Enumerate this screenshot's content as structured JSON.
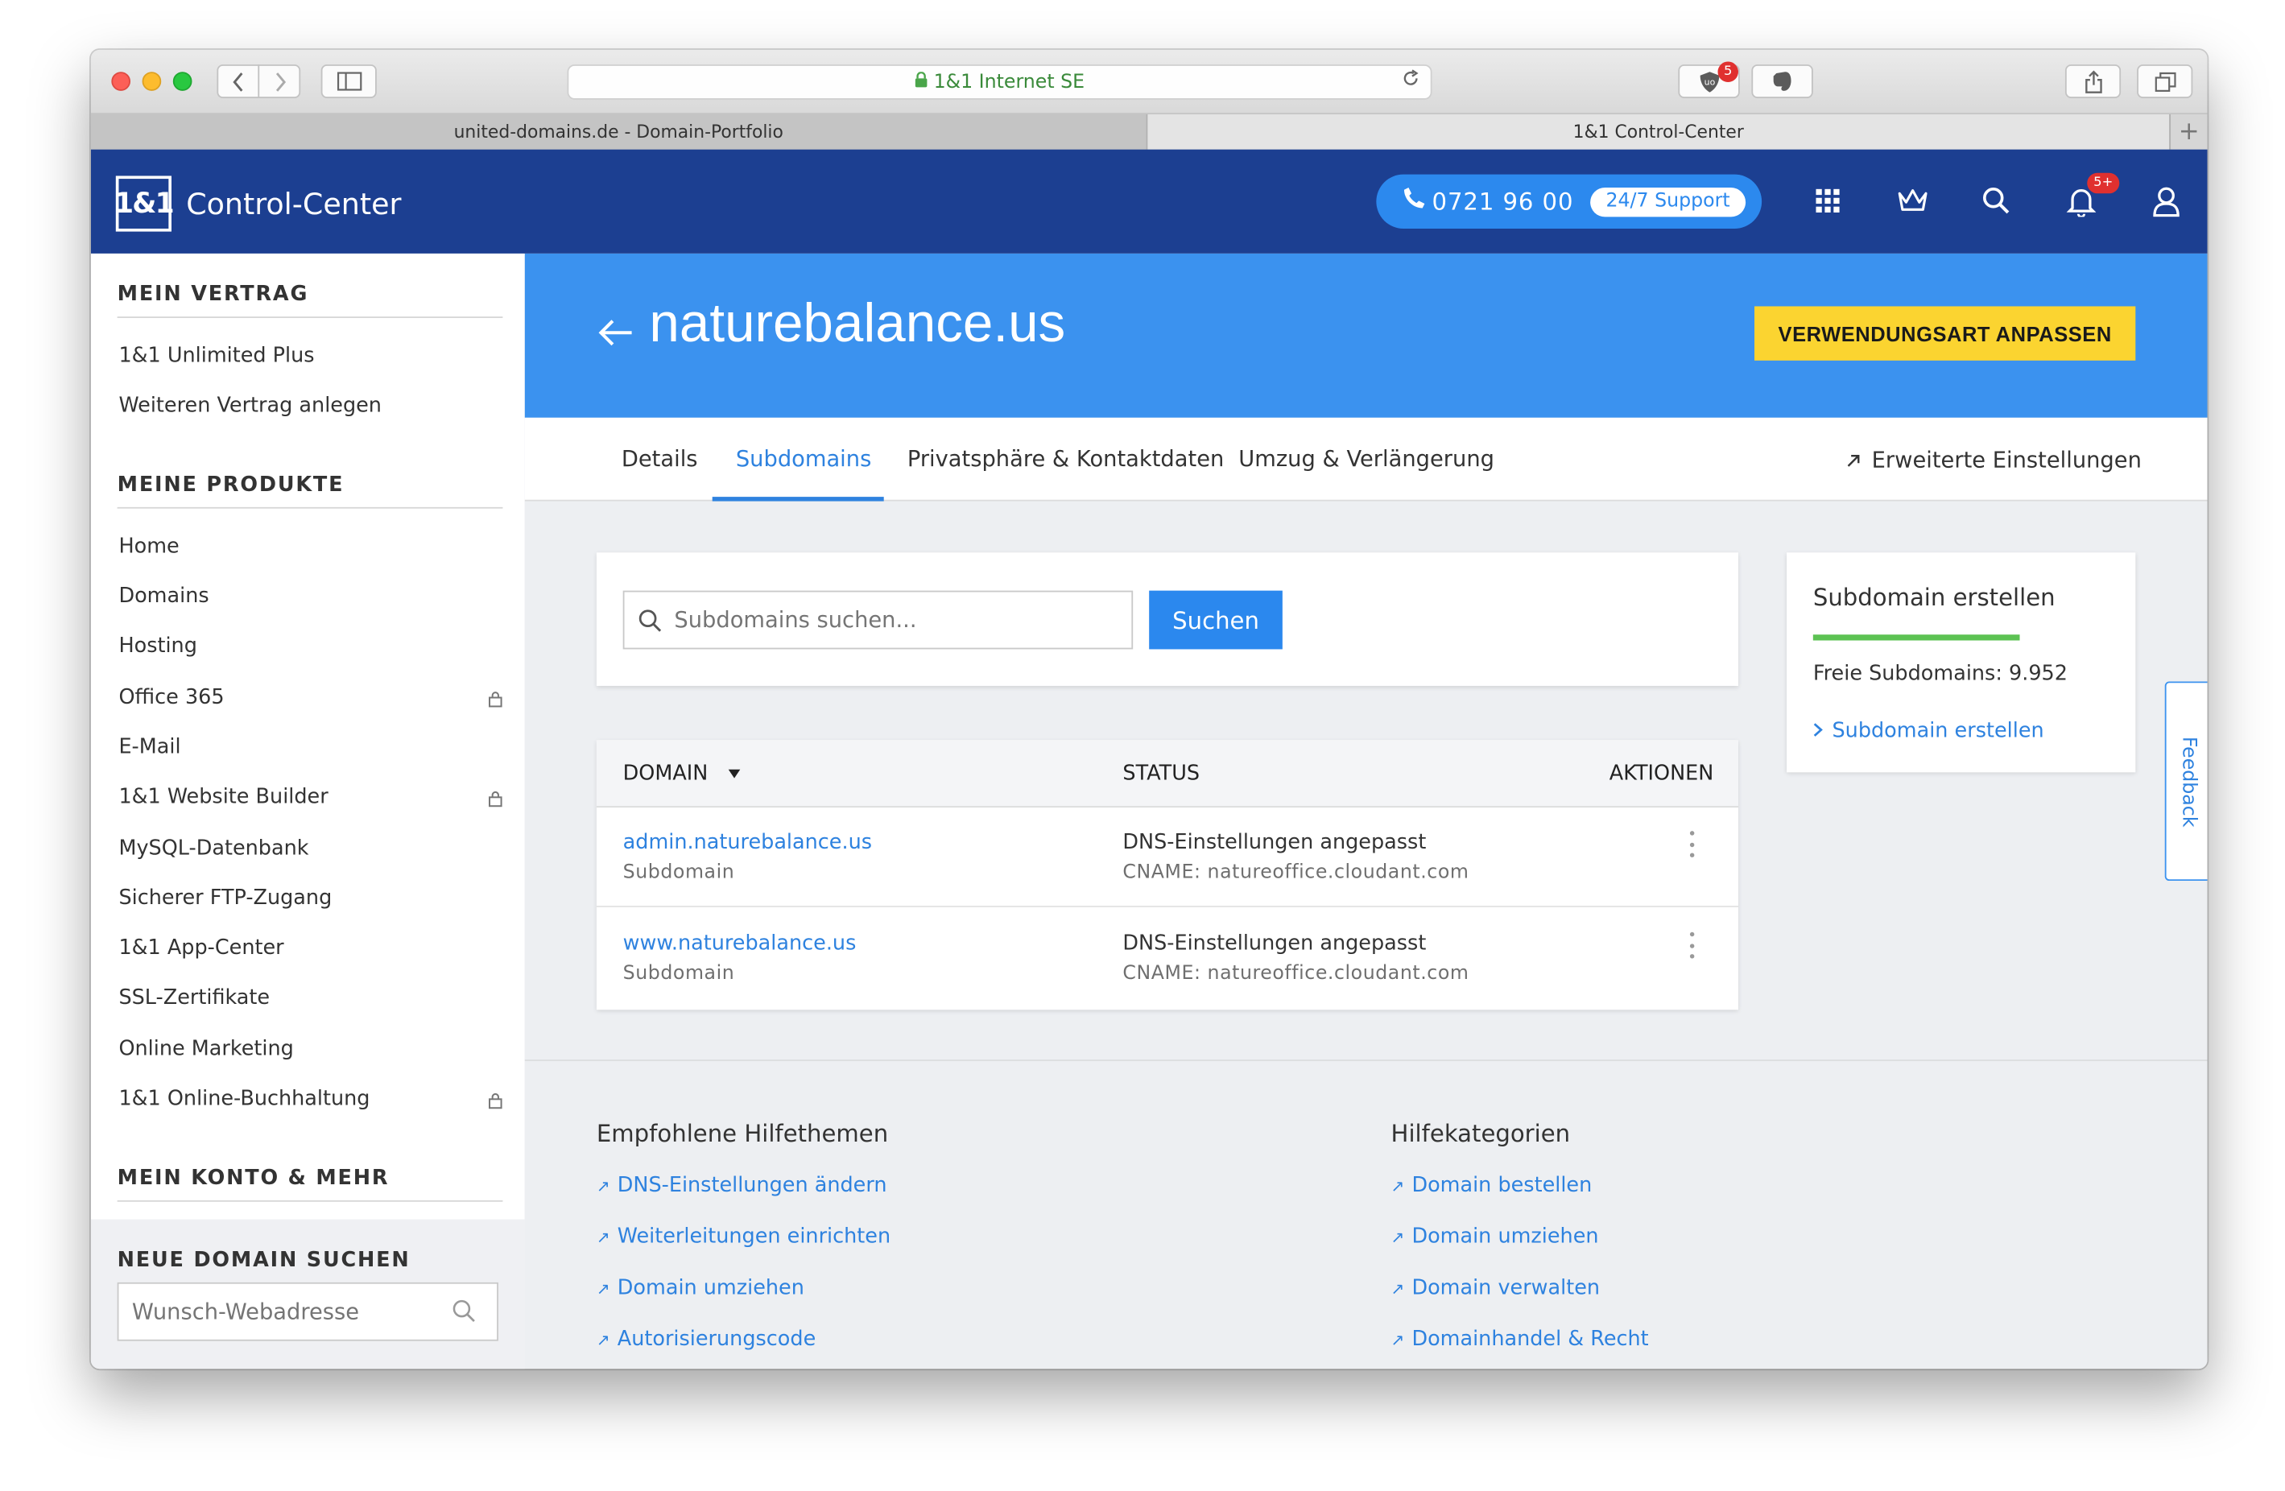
{
  "browser": {
    "url_text": "1&1 Internet SE",
    "ext_badge": "5",
    "tabs": [
      {
        "label": "united-domains.de - Domain-Portfolio"
      },
      {
        "label": "1&1 Control-Center"
      }
    ],
    "new_tab": "+"
  },
  "header": {
    "logo": "1&1",
    "title": "Control-Center",
    "phone": "0721 96 00",
    "support": "24/7 Support",
    "notifications_badge": "5+"
  },
  "sidebar": {
    "sections": [
      {
        "title": "MEIN VERTRAG",
        "items": [
          {
            "label": "1&1 Unlimited Plus"
          },
          {
            "label": "Weiteren Vertrag anlegen"
          }
        ]
      },
      {
        "title": "MEINE PRODUKTE",
        "items": [
          {
            "label": "Home"
          },
          {
            "label": "Domains"
          },
          {
            "label": "Hosting"
          },
          {
            "label": "Office 365",
            "locked": true
          },
          {
            "label": "E-Mail"
          },
          {
            "label": "1&1 Website Builder",
            "locked": true
          },
          {
            "label": "MySQL-Datenbank"
          },
          {
            "label": "Sicherer FTP-Zugang"
          },
          {
            "label": "1&1 App-Center"
          },
          {
            "label": "SSL-Zertifikate"
          },
          {
            "label": "Online Marketing"
          },
          {
            "label": "1&1 Online-Buchhaltung",
            "locked": true
          }
        ]
      },
      {
        "title": "MEIN KONTO & MEHR",
        "items": []
      }
    ],
    "domain_search": {
      "title": "NEUE DOMAIN SUCHEN",
      "placeholder": "Wunsch-Webadresse"
    }
  },
  "page": {
    "title": "naturebalance.us",
    "action_button": "VERWENDUNGSART ANPASSEN",
    "tabs": [
      {
        "label": "Details"
      },
      {
        "label": "Subdomains",
        "active": true
      },
      {
        "label": "Privatsphäre & Kontaktdaten"
      },
      {
        "label": "Umzug & Verlängerung"
      }
    ],
    "advanced_settings": "Erweiterte Einstellungen"
  },
  "search": {
    "placeholder": "Subdomains suchen...",
    "button": "Suchen"
  },
  "table": {
    "headers": {
      "domain": "DOMAIN",
      "status": "STATUS",
      "actions": "AKTIONEN"
    },
    "rows": [
      {
        "domain": "admin.naturebalance.us",
        "type": "Subdomain",
        "status": "DNS-Einstellungen angepasst",
        "detail": "CNAME: natureoffice.cloudant.com"
      },
      {
        "domain": "www.naturebalance.us",
        "type": "Subdomain",
        "status": "DNS-Einstellungen angepasst",
        "detail": "CNAME: natureoffice.cloudant.com"
      }
    ]
  },
  "create_card": {
    "title": "Subdomain erstellen",
    "free": "Freie Subdomains: 9.952",
    "link": "Subdomain erstellen"
  },
  "feedback": "Feedback",
  "help": {
    "recommended": {
      "title": "Empfohlene Hilfethemen",
      "links": [
        "DNS-Einstellungen ändern",
        "Weiterleitungen einrichten",
        "Domain umziehen",
        "Autorisierungscode"
      ]
    },
    "categories": {
      "title": "Hilfekategorien",
      "links": [
        "Domain bestellen",
        "Domain umziehen",
        "Domain verwalten",
        "Domainhandel & Recht"
      ]
    }
  },
  "colors": {
    "header_bg": "#1c3f91",
    "hero_bg": "#3b92ef",
    "accent": "#2e82df",
    "cta": "#fbd430",
    "progress": "#5cc253"
  }
}
